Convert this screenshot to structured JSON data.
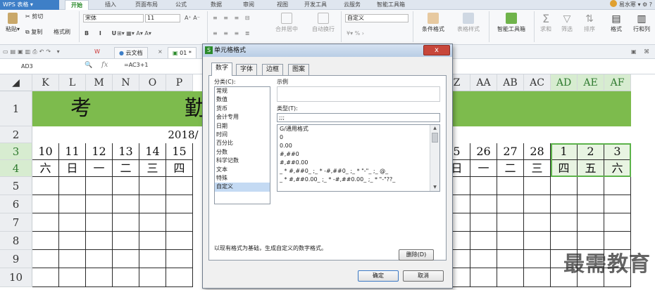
{
  "app": {
    "name": "WPS 表格"
  },
  "ribbon_tabs": [
    {
      "label": "开始",
      "active": true
    },
    {
      "label": "插入"
    },
    {
      "label": "页面布局"
    },
    {
      "label": "公式"
    },
    {
      "label": "数据"
    },
    {
      "label": "审阅"
    },
    {
      "label": "视图"
    },
    {
      "label": "开发工具"
    },
    {
      "label": "云服务"
    },
    {
      "label": "智能工具箱"
    }
  ],
  "user": {
    "name": "易水寒"
  },
  "ribbon": {
    "paste": "粘贴",
    "cut": "剪切",
    "copy": "复制",
    "format_painter": "格式刷",
    "font_name": "宋体",
    "font_size": "11",
    "merge_center": "合并居中",
    "auto_wrap": "自动换行",
    "number_format": "自定义",
    "conditional_format": "条件格式",
    "table_style": "表格样式",
    "smart_toolbox": "智能工具箱",
    "sum": "求和",
    "filter": "筛选",
    "sort": "排序",
    "format": "格式",
    "row_col": "行和列"
  },
  "doc_tabs": [
    {
      "label": "云文档"
    },
    {
      "label": "01"
    }
  ],
  "formula_bar": {
    "name_box": "AD3",
    "fx": "fx",
    "formula": "=AC3+1"
  },
  "sheet": {
    "columns_left": [
      "K",
      "L",
      "M",
      "N",
      "O",
      "P"
    ],
    "columns_right": [
      "Z",
      "AA",
      "AB",
      "AC",
      "AD",
      "AE",
      "AF"
    ],
    "selected_columns": [
      "AD",
      "AE",
      "AF"
    ],
    "rows": [
      "1",
      "2",
      "3",
      "4",
      "5",
      "6",
      "7",
      "8",
      "9",
      "10"
    ],
    "selected_rows": [
      "3",
      "4"
    ],
    "title_char_left": "考",
    "title_char_right": "勤",
    "date_text": "2018/",
    "row3_left": [
      "10",
      "11",
      "12",
      "13",
      "14",
      "15"
    ],
    "row4_left": [
      "六",
      "日",
      "一",
      "二",
      "三",
      "四"
    ],
    "row3_right": [
      "5",
      "26",
      "27",
      "28",
      "1",
      "2",
      "3"
    ],
    "row4_right": [
      "日",
      "一",
      "二",
      "三",
      "四",
      "五",
      "六"
    ],
    "title_fill": "#7dbb4d"
  },
  "dialog": {
    "title": "单元格格式",
    "tabs": [
      {
        "label": "数字",
        "active": true
      },
      {
        "label": "字体"
      },
      {
        "label": "边框"
      },
      {
        "label": "图案"
      }
    ],
    "category_label": "分类(C):",
    "categories": [
      "常规",
      "数值",
      "货币",
      "会计专用",
      "日期",
      "时间",
      "百分比",
      "分数",
      "科学记数",
      "文本",
      "特殊",
      "自定义"
    ],
    "selected_category": "自定义",
    "sample_label": "示例",
    "type_label": "类型(T):",
    "type_value": ";;;",
    "type_options": [
      "G/通用格式",
      "0",
      "0.00",
      "#,##0",
      "#,##0.00",
      "_ * #,##0_ ;_ * -#,##0_ ;_ * \"-\"_ ;_ @_",
      "_ * #,##0.00_ ;_ * -#,##0.00_ ;_ * \"-\"??_"
    ],
    "description": "以现有格式为基础，生成自定义的数字格式。",
    "delete_button": "删除(D)",
    "ok_button": "确定",
    "cancel_button": "取消",
    "close_glyph": "x"
  },
  "watermark": "最需教育"
}
